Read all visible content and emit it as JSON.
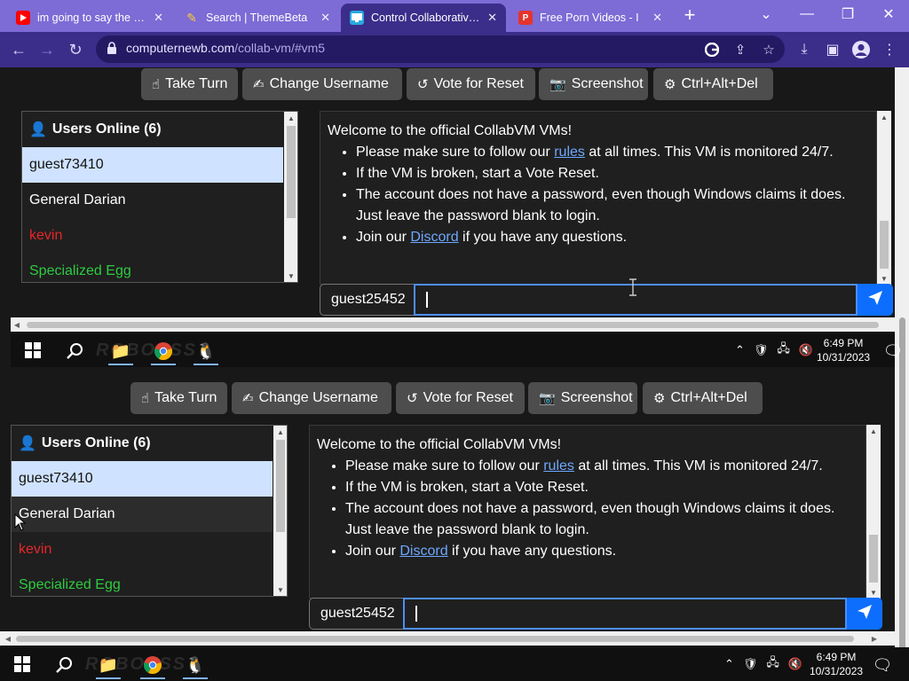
{
  "browser": {
    "tabs": [
      {
        "title": "im going to say the n w",
        "favicon_color": "#ff0000",
        "active": false
      },
      {
        "title": "Search | ThemeBeta",
        "favicon_color": "#e0a800",
        "active": false
      },
      {
        "title": "Control Collaborative V",
        "favicon_color": "#2aa8e0",
        "active": true
      },
      {
        "title": "Free Porn Videos - I",
        "favicon_color": "#e5342b",
        "active": false
      }
    ],
    "new_tab_label": "+",
    "address": {
      "host": "computernewb.com",
      "path": "/collab-vm/#vm5"
    }
  },
  "vm_toolbar": {
    "take_turn": "Take Turn",
    "change_username": "Change Username",
    "vote_reset": "Vote for Reset",
    "screenshot": "Screenshot",
    "ctrl_alt_del": "Ctrl+Alt+Del"
  },
  "users": {
    "header": "Users Online (6)",
    "list": [
      {
        "name": "guest73410",
        "color": "#111111"
      },
      {
        "name": "General Darian",
        "color": "#ffffff"
      },
      {
        "name": "kevin",
        "color": "#e8262b"
      },
      {
        "name": "Specialized Egg",
        "color": "#2ecc40"
      }
    ]
  },
  "chat": {
    "welcome": "Welcome to the official CollabVM VMs!",
    "rules_pre": "Please make sure to follow our ",
    "rules_link": "rules",
    "rules_post": " at all times. This VM is monitored 24/7.",
    "broken": "If the VM is broken, start a Vote Reset.",
    "password": "The account does not have a password, even though Windows claims it does. Just leave the password blank to login.",
    "join_pre": "Join our ",
    "discord_link": "Discord",
    "join_post": " if you have any questions.",
    "username": "guest25452",
    "input_value": ""
  },
  "taskbar": {
    "time": "6:49 PM",
    "date": "10/31/2023"
  }
}
